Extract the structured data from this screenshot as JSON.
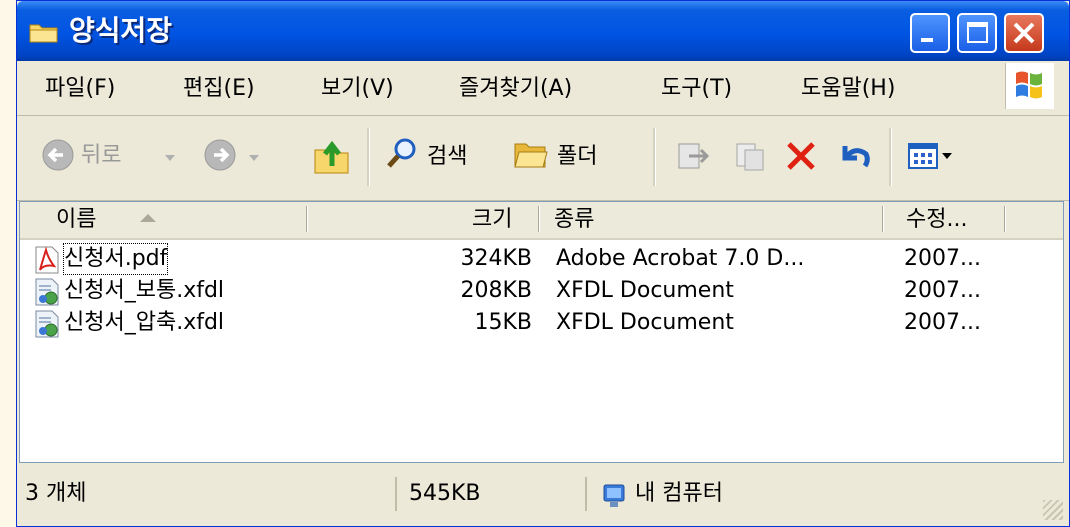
{
  "window": {
    "title": "양식저장",
    "title_icon": "folder-icon"
  },
  "menubar": {
    "items": [
      "파일(F)",
      "편집(E)",
      "보기(V)",
      "즐겨찾기(A)",
      "도구(T)",
      "도움말(H)"
    ]
  },
  "toolbar": {
    "back_label": "뒤로",
    "search_label": "검색",
    "folders_label": "폴더"
  },
  "columns": {
    "name": "이름",
    "size": "크기",
    "type": "종류",
    "modified": "수정..."
  },
  "files": [
    {
      "name": "신청서.pdf",
      "size": "324KB",
      "type": "Adobe Acrobat 7.0 D...",
      "modified": "2007...",
      "icon": "pdf-file-icon"
    },
    {
      "name": "신청서_보통.xfdl",
      "size": "208KB",
      "type": "XFDL Document",
      "modified": "2007...",
      "icon": "xfdl-file-icon"
    },
    {
      "name": "신청서_압축.xfdl",
      "size": "15KB",
      "type": "XFDL Document",
      "modified": "2007...",
      "icon": "xfdl-file-icon"
    }
  ],
  "statusbar": {
    "count": "3 개체",
    "total_size": "545KB",
    "location": "내 컴퓨터"
  },
  "colors": {
    "titlebar": "#0054e3",
    "close_button": "#c5391c",
    "delete_x": "#e02010"
  }
}
